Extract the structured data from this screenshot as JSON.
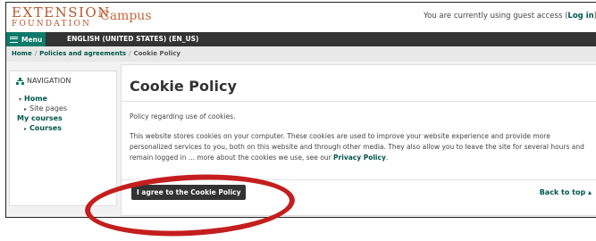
{
  "header": {
    "logo_line1": "EXTENSION",
    "logo_line2": "FOUNDATION",
    "site_name": "Campus",
    "guest_text": "You are currently using guest access (",
    "login_label": "Log in",
    "guest_end": ")"
  },
  "menubar": {
    "menu_label": "Menu",
    "language": "ENGLISH (UNITED STATES) (EN_US)"
  },
  "breadcrumb": {
    "home": "Home",
    "policies": "Policies and agreements",
    "current": "Cookie Policy",
    "sep": "/"
  },
  "navigation": {
    "heading": "NAVIGATION",
    "home": "Home",
    "site_pages": "Site pages",
    "my_courses": "My courses",
    "courses": "Courses"
  },
  "main": {
    "title": "Cookie Policy",
    "summary": "Policy regarding use of cookies.",
    "body_pre": "This website stores cookies on your computer. These cookies are used to improve your website experience and provide more personalized services to you, both on this website and through other media. They also allow you to leave the site for several hours and remain logged in ... more about the cookies we use, see our ",
    "privacy_link": "Privacy Policy",
    "body_post": ".",
    "agree_button": "I agree to the Cookie Policy",
    "back_to_top": "Back to top ▴"
  },
  "colors": {
    "accent": "#0d7a6a",
    "link": "#00564d",
    "brand": "#b5562a",
    "highlight_oval": "#c41e1e"
  }
}
